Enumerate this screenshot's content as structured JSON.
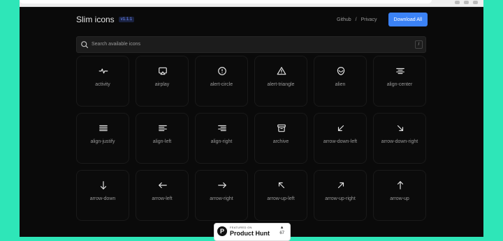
{
  "header": {
    "title": "Slim icons",
    "version": "v1.1.1",
    "nav": {
      "github": "Github",
      "separator": "/",
      "privacy": "Privacy"
    },
    "download_label": "Download All",
    "accent_color": "#3b82f6"
  },
  "search": {
    "placeholder": "Search available icons",
    "shortcut": "/"
  },
  "icons": [
    {
      "label": "activity",
      "icon": "activity-icon"
    },
    {
      "label": "airplay",
      "icon": "airplay-icon"
    },
    {
      "label": "alert-circle",
      "icon": "alert-circle-icon"
    },
    {
      "label": "alert-triangle",
      "icon": "alert-triangle-icon"
    },
    {
      "label": "alien",
      "icon": "alien-icon"
    },
    {
      "label": "align-center",
      "icon": "align-center-icon"
    },
    {
      "label": "align-justify",
      "icon": "align-justify-icon"
    },
    {
      "label": "align-left",
      "icon": "align-left-icon"
    },
    {
      "label": "align-right",
      "icon": "align-right-icon"
    },
    {
      "label": "archive",
      "icon": "archive-icon"
    },
    {
      "label": "arrow-down-left",
      "icon": "arrow-down-left-icon"
    },
    {
      "label": "arrow-down-right",
      "icon": "arrow-down-right-icon"
    },
    {
      "label": "arrow-down",
      "icon": "arrow-down-icon"
    },
    {
      "label": "arrow-left",
      "icon": "arrow-left-icon"
    },
    {
      "label": "arrow-right",
      "icon": "arrow-right-icon"
    },
    {
      "label": "arrow-up-left",
      "icon": "arrow-up-left-icon"
    },
    {
      "label": "arrow-up-right",
      "icon": "arrow-up-right-icon"
    },
    {
      "label": "arrow-up",
      "icon": "arrow-up-icon"
    }
  ],
  "product_hunt": {
    "featured": "FEATURED ON",
    "name": "Product Hunt",
    "logo_letter": "P",
    "upvote_arrow": "▲",
    "votes": "67"
  }
}
